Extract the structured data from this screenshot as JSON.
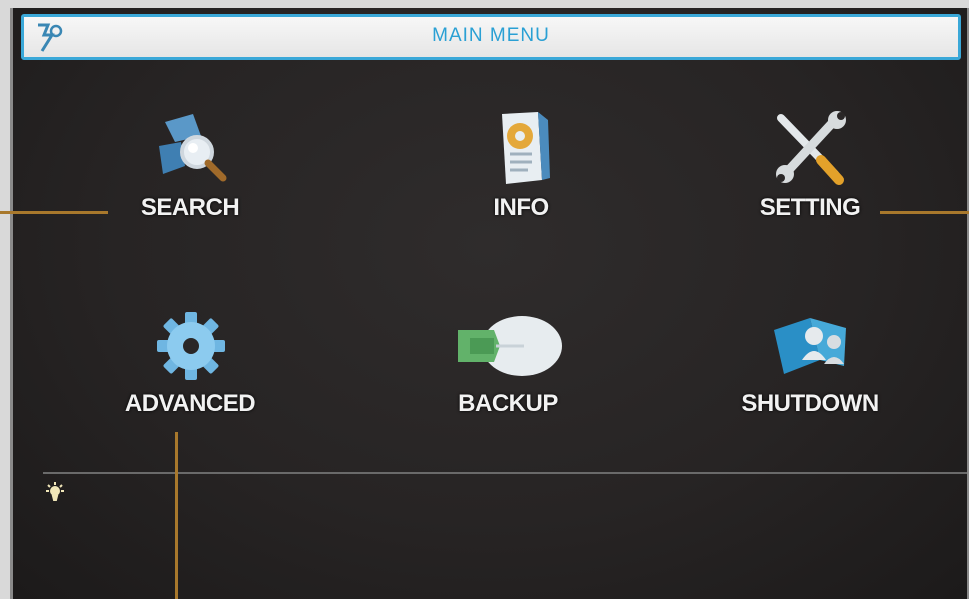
{
  "window": {
    "title": "MAIN MENU"
  },
  "menu": {
    "search": "SEARCH",
    "info": "INFO",
    "setting": "SETTING",
    "advanced": "ADVANCED",
    "backup": "BACKUP",
    "shutdown": "SHUTDOWN"
  },
  "icons": {
    "logo": "dvr-logo-icon",
    "search": "magnifier-icon",
    "info": "info-document-icon",
    "setting": "wrench-screwdriver-icon",
    "advanced": "gear-icon",
    "backup": "backup-drive-icon",
    "shutdown": "power-users-icon",
    "tip": "bulb-icon"
  },
  "colors": {
    "accent": "#3aa8d8",
    "background": "#272424",
    "label": "#f2f2f2",
    "callout": "#a8782c"
  }
}
